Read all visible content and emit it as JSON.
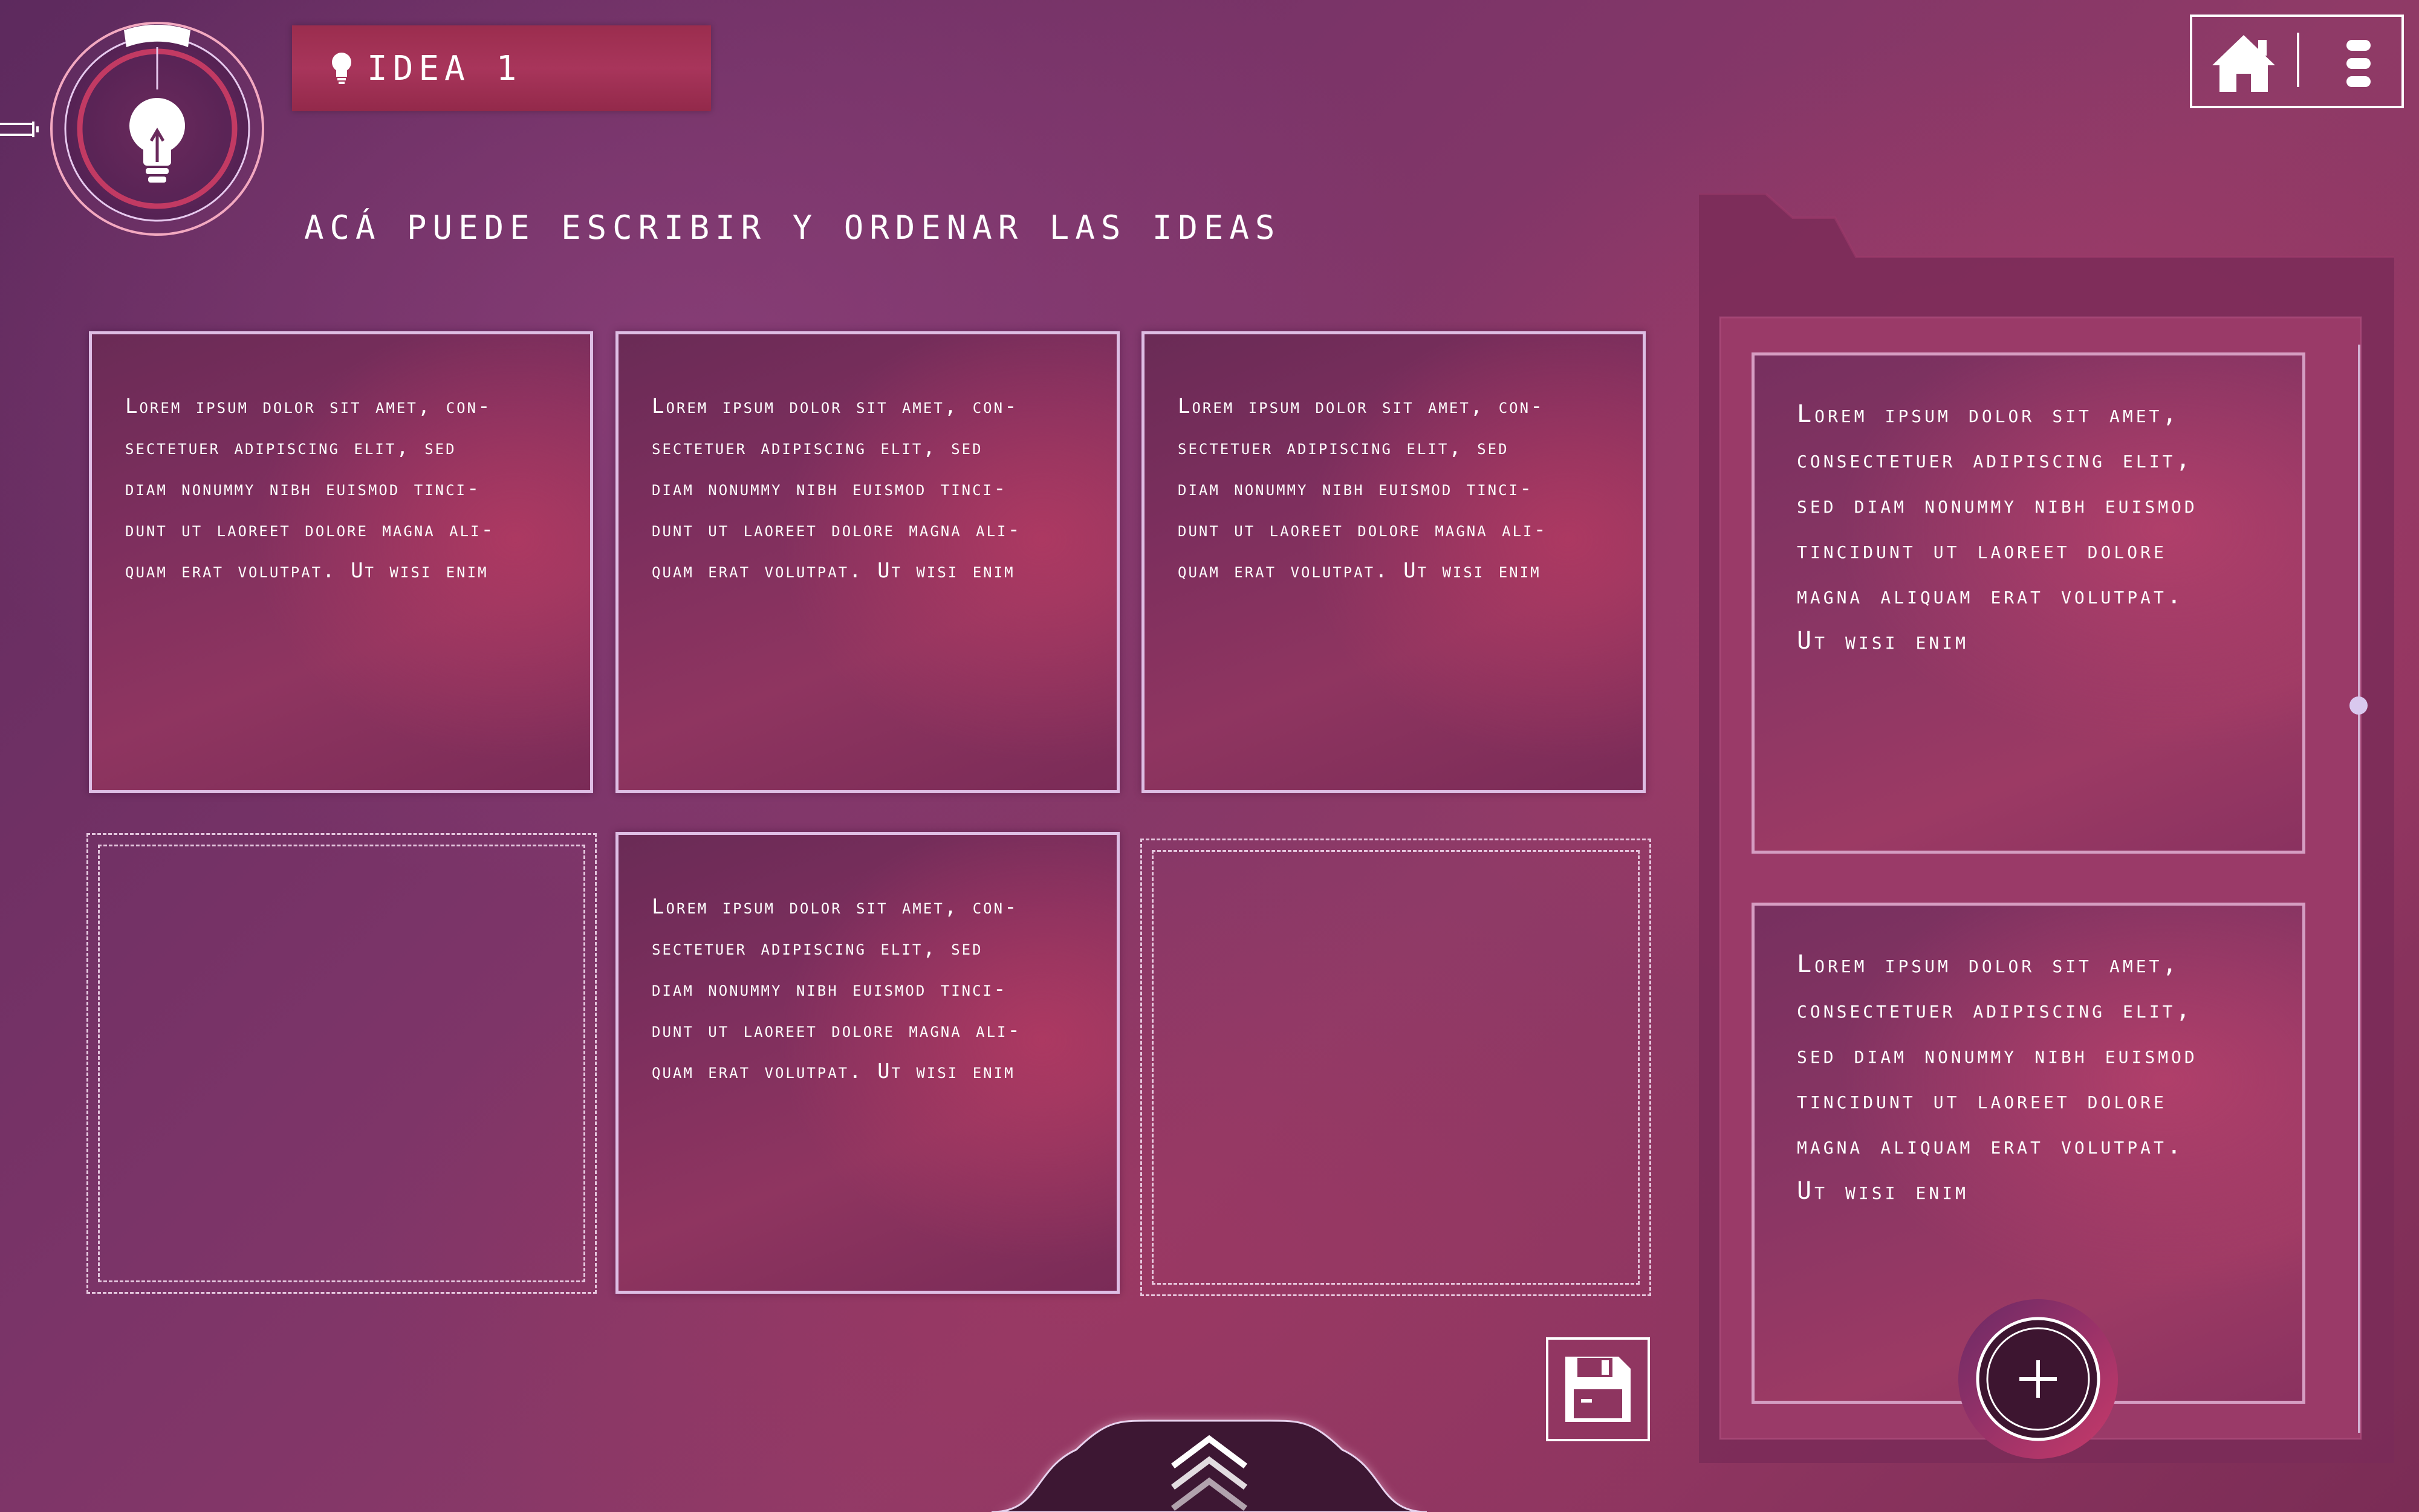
{
  "header": {
    "idea_title": "IDEA 1",
    "subtitle": "ACÁ PUEDE ESCRIBIR Y ORDENAR LAS IDEAS"
  },
  "board": {
    "cards": [
      {
        "text": "Lorem ipsum dolor sit amet, con-\nsectetuer adipiscing elit, sed\ndiam nonummy nibh euismod tinci-\ndunt ut laoreet dolore magna ali-\nquam erat volutpat. Ut wisi enim"
      },
      {
        "text": "Lorem ipsum dolor sit amet, con-\nsectetuer adipiscing elit, sed\ndiam nonummy nibh euismod tinci-\ndunt ut laoreet dolore magna ali-\nquam erat volutpat. Ut wisi enim"
      },
      {
        "text": "Lorem ipsum dolor sit amet, con-\nsectetuer adipiscing elit, sed\ndiam nonummy nibh euismod tinci-\ndunt ut laoreet dolore magna ali-\nquam erat volutpat. Ut wisi enim"
      },
      {
        "text": "Lorem ipsum dolor sit amet, con-\nsectetuer adipiscing elit, sed\ndiam nonummy nibh euismod tinci-\ndunt ut laoreet dolore magna ali-\nquam erat volutpat. Ut wisi enim"
      }
    ]
  },
  "side_panel": {
    "cards": [
      {
        "text": "Lorem ipsum dolor sit amet,\nconsectetuer adipiscing elit,\nsed diam nonummy nibh euismod\ntincidunt ut laoreet dolore\nmagna aliquam erat volutpat.\nUt wisi enim"
      },
      {
        "text": "Lorem ipsum dolor sit amet,\nconsectetuer adipiscing elit,\nsed diam nonummy nibh euismod\ntincidunt ut laoreet dolore\nmagna aliquam erat volutpat.\nUt wisi enim"
      }
    ]
  },
  "icons": {
    "logo": "lightbulb-icon",
    "tab": "lightbulb-icon",
    "home": "home-icon",
    "menu": "menu-icon",
    "save": "floppy-disk-icon",
    "drawer": "chevron-up-icon",
    "add": "plus-icon"
  },
  "colors": {
    "background": "#7b3468",
    "accent": "#a8355b",
    "card_border": "#e4c6ec",
    "text": "#ffffff"
  }
}
